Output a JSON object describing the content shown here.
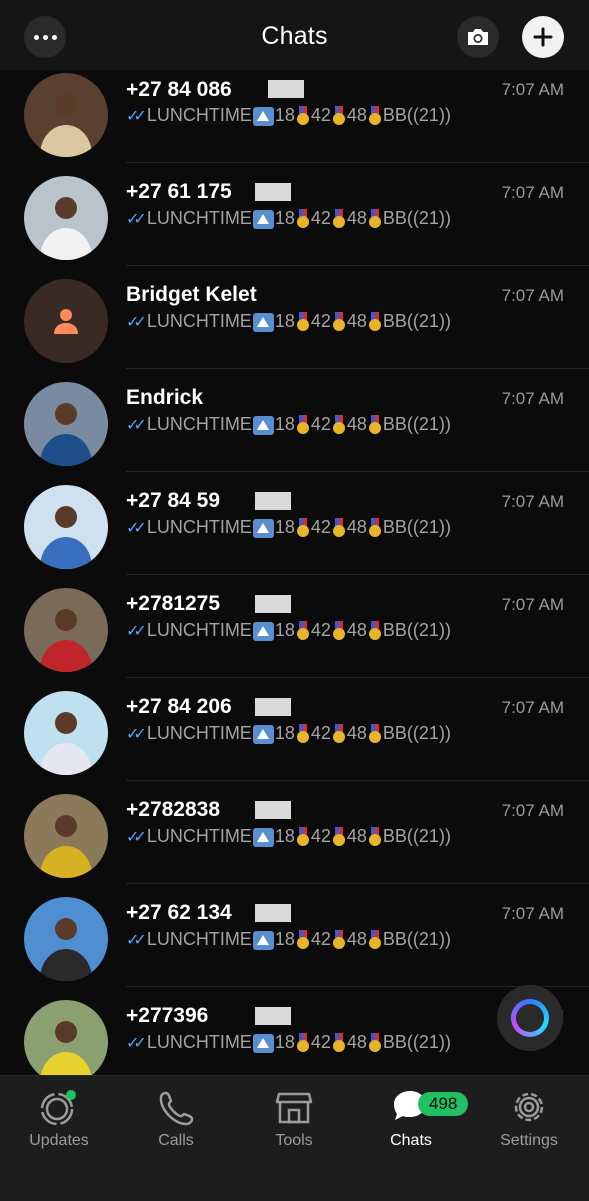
{
  "header": {
    "title": "Chats",
    "menu_icon": "more-horizontal-icon",
    "camera_icon": "camera-icon",
    "new_icon": "plus-icon"
  },
  "message_preview": {
    "text_start": "LUNCHTIME",
    "n1": "18",
    "n2": "42",
    "n3": "48",
    "end": "BB((21))"
  },
  "chats": [
    {
      "name": "+27 84 086",
      "time": "7:07 AM",
      "avatar": "photo",
      "colors": [
        "#5a4030",
        "#d9c8a0"
      ]
    },
    {
      "name": "+27 61 175",
      "time": "7:07 AM",
      "avatar": "photo",
      "colors": [
        "#b8c3cc",
        "#f2f2f2"
      ]
    },
    {
      "name": "Bridget Kelet",
      "time": "7:07 AM",
      "avatar": "placeholder",
      "colors": [
        "#3a2a24",
        "#ff8a5c"
      ]
    },
    {
      "name": "Endrick",
      "time": "7:07 AM",
      "avatar": "photo",
      "colors": [
        "#7a8aa0",
        "#1f4f8a"
      ]
    },
    {
      "name": "+27 84 59",
      "time": "7:07 AM",
      "avatar": "photo",
      "colors": [
        "#cfe0ef",
        "#3a6fbf"
      ]
    },
    {
      "name": "+2781275",
      "time": "7:07 AM",
      "avatar": "photo",
      "colors": [
        "#7a6a5a",
        "#c0252a"
      ]
    },
    {
      "name": "+27 84 206",
      "time": "7:07 AM",
      "avatar": "photo",
      "colors": [
        "#bfe0ef",
        "#e6e6f2"
      ]
    },
    {
      "name": "+2782838",
      "time": "7:07 AM",
      "avatar": "photo",
      "colors": [
        "#8a7a5a",
        "#d6b222"
      ]
    },
    {
      "name": "+27 62 134",
      "time": "7:07 AM",
      "avatar": "photo",
      "colors": [
        "#4f8fd1",
        "#2a2a2a"
      ]
    },
    {
      "name": "+277396",
      "time": "7:07 AM",
      "avatar": "photo",
      "colors": [
        "#8aa070",
        "#e8d230"
      ]
    }
  ],
  "nav": {
    "updates": "Updates",
    "calls": "Calls",
    "tools": "Tools",
    "chats": "Chats",
    "settings": "Settings",
    "chats_badge": "498"
  },
  "colors": {
    "accent_green": "#21c063",
    "read_tick_blue": "#53a6ff"
  }
}
